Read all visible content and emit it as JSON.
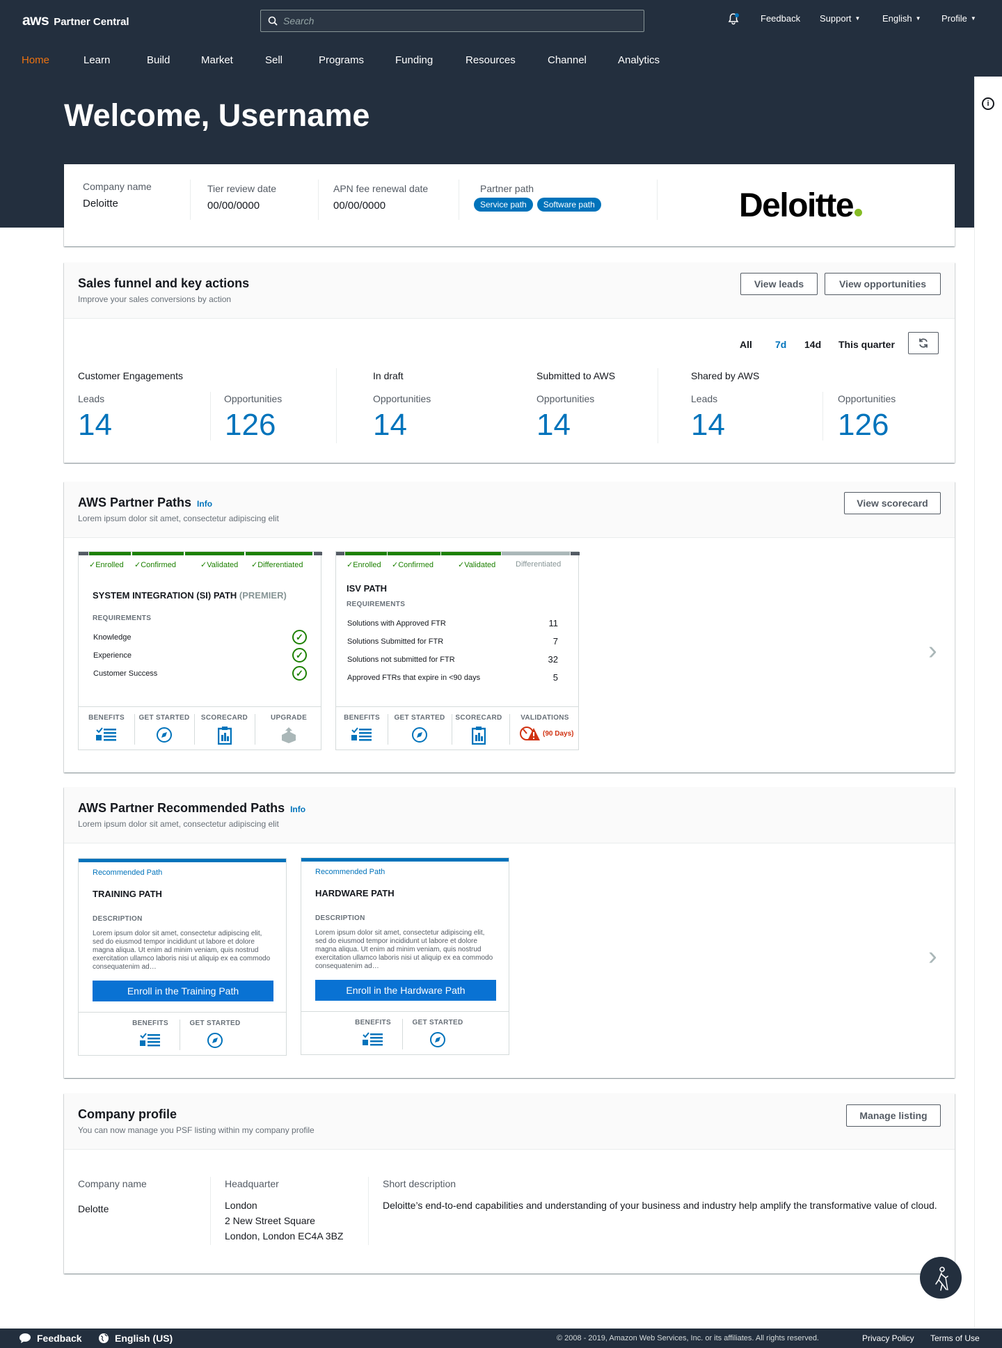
{
  "header": {
    "logo_aws": "aws",
    "logo_product": "Partner Central",
    "search_placeholder": "Search",
    "links": {
      "feedback": "Feedback",
      "support": "Support",
      "language": "English",
      "profile": "Profile"
    }
  },
  "nav": [
    "Home",
    "Learn",
    "Build",
    "Market",
    "Sell",
    "Programs",
    "Funding",
    "Resources",
    "Channel",
    "Analytics"
  ],
  "welcome": "Welcome, Username",
  "summary": {
    "company_label": "Company name",
    "company_value": "Deloitte",
    "tier_label": "Tier review date",
    "tier_value": "00/00/0000",
    "apn_label": "APN fee renewal date",
    "apn_value": "00/00/0000",
    "path_label": "Partner path",
    "path_pills": [
      "Service path",
      "Software path"
    ],
    "logo_text": "Deloitte"
  },
  "funnel": {
    "title": "Sales funnel and key actions",
    "subtitle": "Improve your sales conversions by action",
    "btn_leads": "View leads",
    "btn_opps": "View opportunities",
    "filters": [
      "All",
      "7d",
      "14d",
      "This quarter"
    ],
    "selected_filter": "7d",
    "groups": {
      "customer": "Customer Engagements",
      "draft": "In draft",
      "submitted": "Submitted to AWS",
      "shared": "Shared by AWS"
    },
    "metrics": [
      {
        "label": "Leads",
        "value": "14"
      },
      {
        "label": "Opportunities",
        "value": "126"
      },
      {
        "label": "Opportunities",
        "value": "14"
      },
      {
        "label": "Opportunities",
        "value": "14"
      },
      {
        "label": "Leads",
        "value": "14"
      },
      {
        "label": "Opportunities",
        "value": "126"
      }
    ]
  },
  "paths": {
    "title": "AWS Partner Paths",
    "info": "Info",
    "subtitle": "Lorem ipsum dolor sit amet, consectetur adipiscing elit",
    "btn_scorecard": "View scorecard",
    "si": {
      "stages": [
        "✓Enrolled",
        "✓Confirmed",
        "✓Validated",
        "✓Differentiated"
      ],
      "title": "SYSTEM INTEGRATION (SI) PATH",
      "title_sub": "(PREMIER)",
      "req_head": "REQUIREMENTS",
      "reqs": [
        "Knowledge",
        "Experience",
        "Customer Success"
      ],
      "footer": [
        "BENEFITS",
        "GET STARTED",
        "SCORECARD",
        "UPGRADE"
      ]
    },
    "isv": {
      "stages": [
        "✓Enrolled",
        "✓Confirmed",
        "✓Validated",
        "Differentiated"
      ],
      "title": "ISV PATH",
      "req_head": "REQUIREMENTS",
      "reqs": [
        {
          "label": "Solutions with Approved FTR",
          "value": "11"
        },
        {
          "label": "Solutions Submitted for FTR",
          "value": "7"
        },
        {
          "label": "Solutions not submitted for FTR",
          "value": "32"
        },
        {
          "label": "Approved FTRs that expire in <90 days",
          "value": "5"
        }
      ],
      "footer": [
        "BENEFITS",
        "GET STARTED",
        "SCORECARD",
        "VALIDATIONS"
      ],
      "validation_note": "(90 Days)"
    }
  },
  "recommended": {
    "title": "AWS Partner Recommended Paths",
    "info": "Info",
    "subtitle": "Lorem ipsum dolor sit amet, consectetur adipiscing elit",
    "cards": [
      {
        "tag": "Recommended Path",
        "title": "TRAINING PATH",
        "desc_head": "DESCRIPTION",
        "desc": "Lorem ipsum dolor sit amet, consectetur adipiscing elit, sed do eiusmod tempor incididunt ut labore et dolore magna aliqua. Ut enim ad minim veniam, quis nostrud exercitation ullamco laboris nisi ut aliquip ex ea commodo consequatenim ad…",
        "button": "Enroll in the Training Path",
        "footer": [
          "BENEFITS",
          "GET STARTED"
        ]
      },
      {
        "tag": "Recommended Path",
        "title": "HARDWARE PATH",
        "desc_head": "DESCRIPTION",
        "desc": "Lorem ipsum dolor sit amet, consectetur adipiscing elit, sed do eiusmod tempor incididunt ut labore et dolore magna aliqua. Ut enim ad minim veniam, quis nostrud exercitation ullamco laboris nisi ut aliquip ex ea commodo consequatenim ad…",
        "button": "Enroll in the Hardware Path",
        "footer": [
          "BENEFITS",
          "GET STARTED"
        ]
      }
    ]
  },
  "profile": {
    "title": "Company profile",
    "subtitle": "You can now manage you PSF listing within my company profile",
    "btn_manage": "Manage listing",
    "company_label": "Company name",
    "company_value": "Delotte",
    "hq_label": "Headquarter",
    "hq_lines": [
      "London",
      "2 New Street Square",
      "London, London EC4A 3BZ"
    ],
    "desc_label": "Short description",
    "desc_value": "Deloitte’s end-to-end capabilities and understanding of your business and industry help amplify the transformative value of cloud."
  },
  "footer": {
    "feedback": "Feedback",
    "language": "English (US)",
    "copyright": "© 2008 - 2019, Amazon Web Services, Inc. or its affiliates. All rights reserved.",
    "privacy": "Privacy Policy",
    "terms": "Terms of Use"
  },
  "colors": {
    "header_bg": "#232f3e",
    "accent_orange": "#ec7211",
    "link_blue": "#0073bb",
    "success_green": "#1d8102",
    "error_red": "#d13212"
  },
  "icons": [
    "notification-bell-icon",
    "search-icon",
    "info-circle-icon",
    "refresh-icon",
    "checkmark-circle-icon",
    "benefits-list-icon",
    "compass-icon",
    "clipboard-icon",
    "upgrade-box-icon",
    "warning-timer-icon",
    "chevron-right-icon",
    "accessibility-walker-icon",
    "chat-bubble-icon",
    "globe-icon"
  ]
}
